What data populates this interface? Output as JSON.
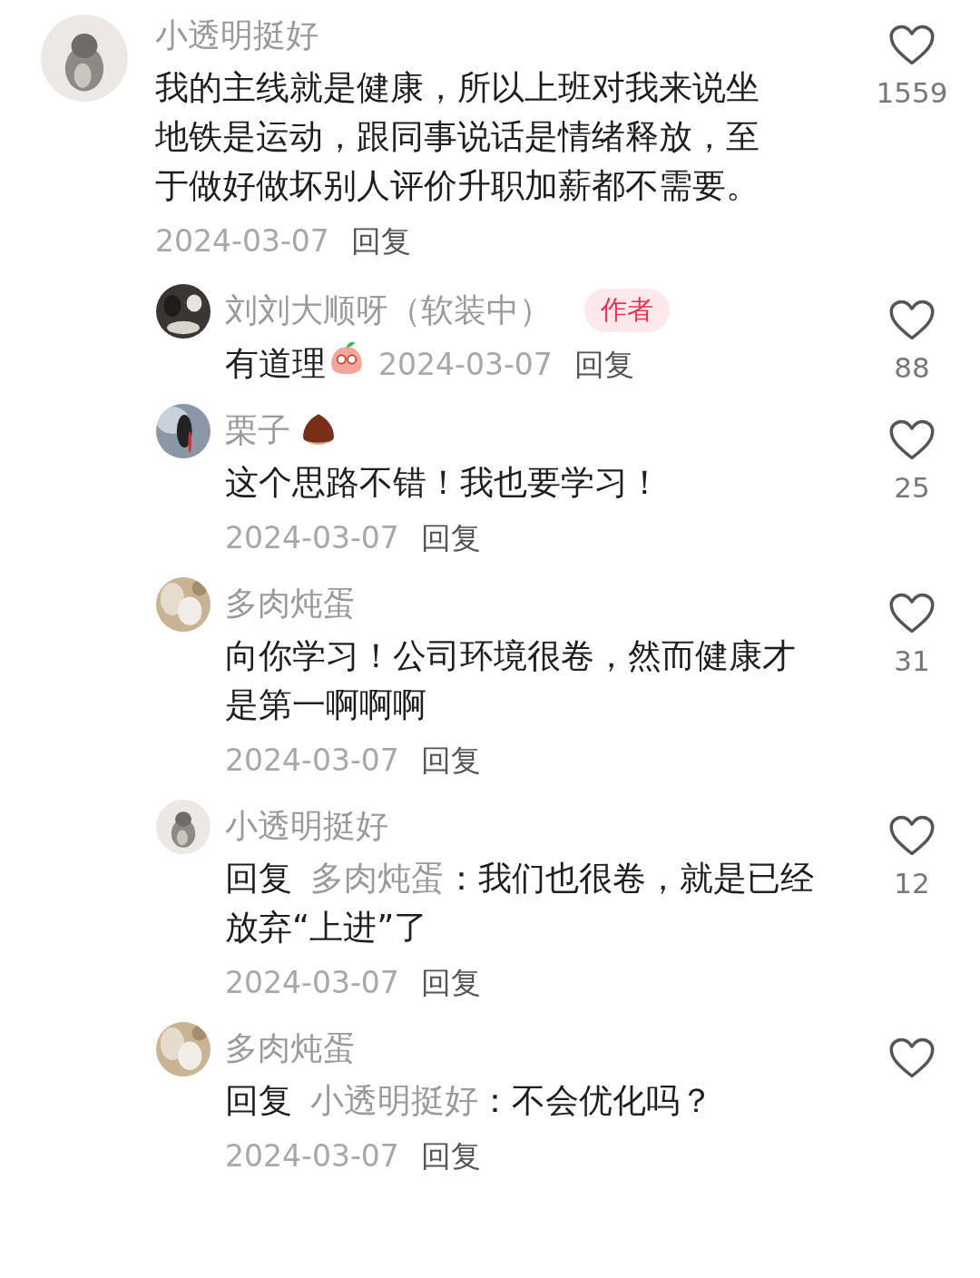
{
  "comment": {
    "author": "小透明挺好",
    "text": "我的主线就是健康，所以上班对我来说坐地铁是运动，跟同事说话是情绪释放，至于做好做坏别人评价升职加薪都不需要。",
    "date": "2024-03-07",
    "reply_label": "回复",
    "likes": "1559",
    "date_own_line": true
  },
  "replies": [
    {
      "author": "刘刘大顺呀（软装中）",
      "badge": "作者",
      "text": "有道理",
      "text_emoji": true,
      "date": "2024-03-07",
      "reply_label": "回复",
      "likes": "88",
      "date_own_line": false
    },
    {
      "author": "栗子",
      "name_emoji": true,
      "text": "这个思路不错！我也要学习！",
      "date": "2024-03-07",
      "reply_label": "回复",
      "likes": "25",
      "date_own_line": true
    },
    {
      "author": "多肉炖蛋",
      "text": "向你学习！公司环境很卷，然而健康才是第一啊啊啊",
      "date": "2024-03-07",
      "reply_label": "回复",
      "likes": "31",
      "date_own_line": true
    },
    {
      "author": "小透明挺好",
      "reply_to": {
        "label": "回复",
        "name": "多肉炖蛋"
      },
      "text": "：我们也很卷，就是已经放弃“上进”了",
      "date": "2024-03-07",
      "reply_label": "回复",
      "likes": "12",
      "date_own_line": true
    },
    {
      "author": "多肉炖蛋",
      "reply_to": {
        "label": "回复",
        "name": "小透明挺好"
      },
      "text": "：不会优化吗？",
      "date": "2024-03-07",
      "reply_label": "回复",
      "date_own_line": true
    }
  ]
}
